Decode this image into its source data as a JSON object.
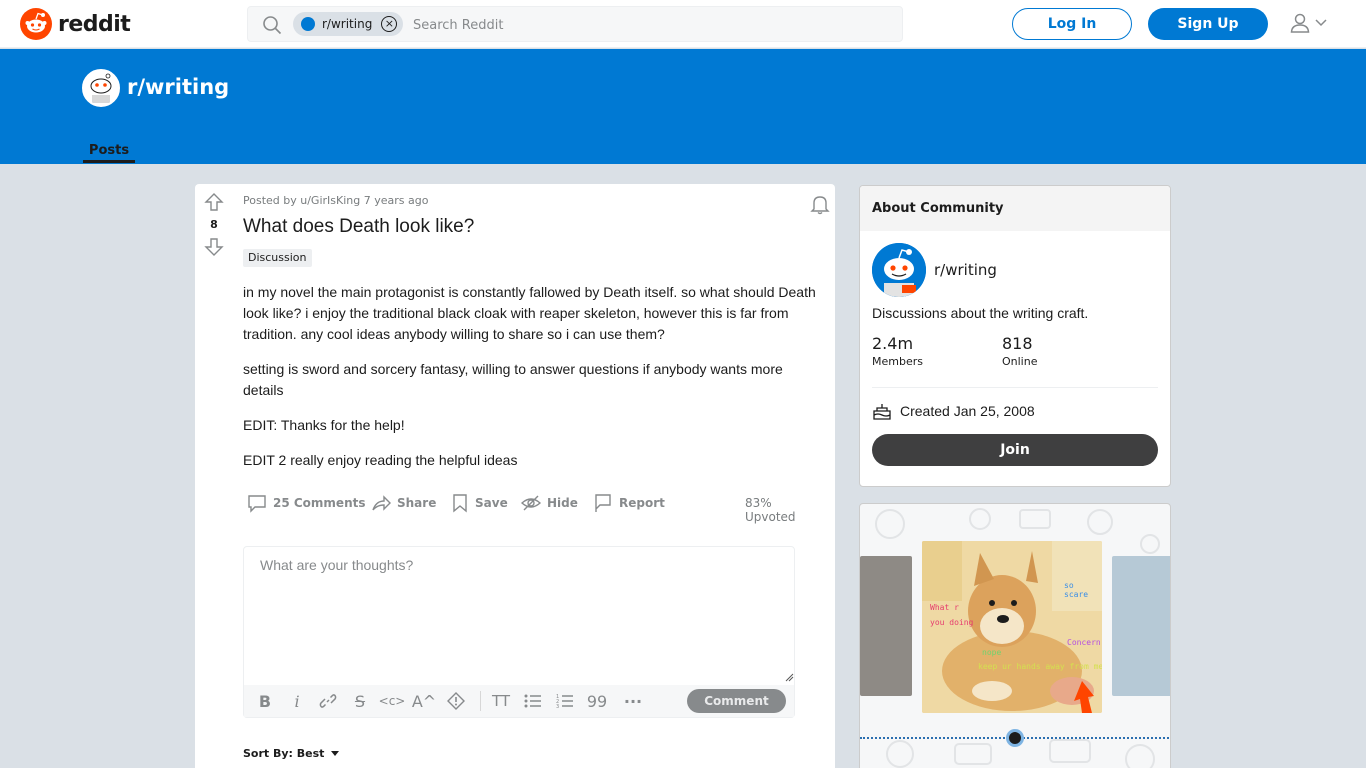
{
  "header": {
    "brand": "reddit",
    "search_chip": "r/writing",
    "search_placeholder": "Search Reddit",
    "login_label": "Log In",
    "signup_label": "Sign Up"
  },
  "banner": {
    "subreddit": "r/writing",
    "tab_posts": "Posts"
  },
  "post": {
    "votes": "8",
    "meta": "Posted by u/GirIsKing 7 years ago",
    "title": "What does Death look like?",
    "flair": "Discussion",
    "body": [
      "in my novel the main protagonist is constantly fallowed by Death itself. so what should Death look like? i enjoy the traditional black cloak with reaper skeleton, however this is far from tradition. any cool ideas anybody willing to share so i can use them?",
      "setting is sword and sorcery fantasy, willing to answer questions if anybody wants more details",
      "EDIT: Thanks for the help!",
      "EDIT 2 really enjoy reading the helpful ideas"
    ],
    "actions": {
      "comments": "25 Comments",
      "share": "Share",
      "save": "Save",
      "hide": "Hide",
      "report": "Report"
    },
    "upvoted": "83% Upvoted",
    "comment_placeholder": "What are your thoughts?",
    "comment_button": "Comment",
    "sort_by": "Sort By: Best"
  },
  "about": {
    "heading": "About Community",
    "name": "r/writing",
    "description": "Discussions about the writing craft.",
    "members_count": "2.4m",
    "members_label": "Members",
    "online_count": "818",
    "online_label": "Online",
    "created": "Created Jan 25, 2008",
    "join_label": "Join"
  },
  "promo": {
    "meme_lines": [
      "so scare",
      "What r",
      "you doing",
      "nope",
      "Concern",
      "keep ur hands away from me"
    ]
  },
  "colors": {
    "brand_orange": "#ff4500",
    "primary_blue": "#0079d3",
    "join_dark": "#3f3f40"
  }
}
